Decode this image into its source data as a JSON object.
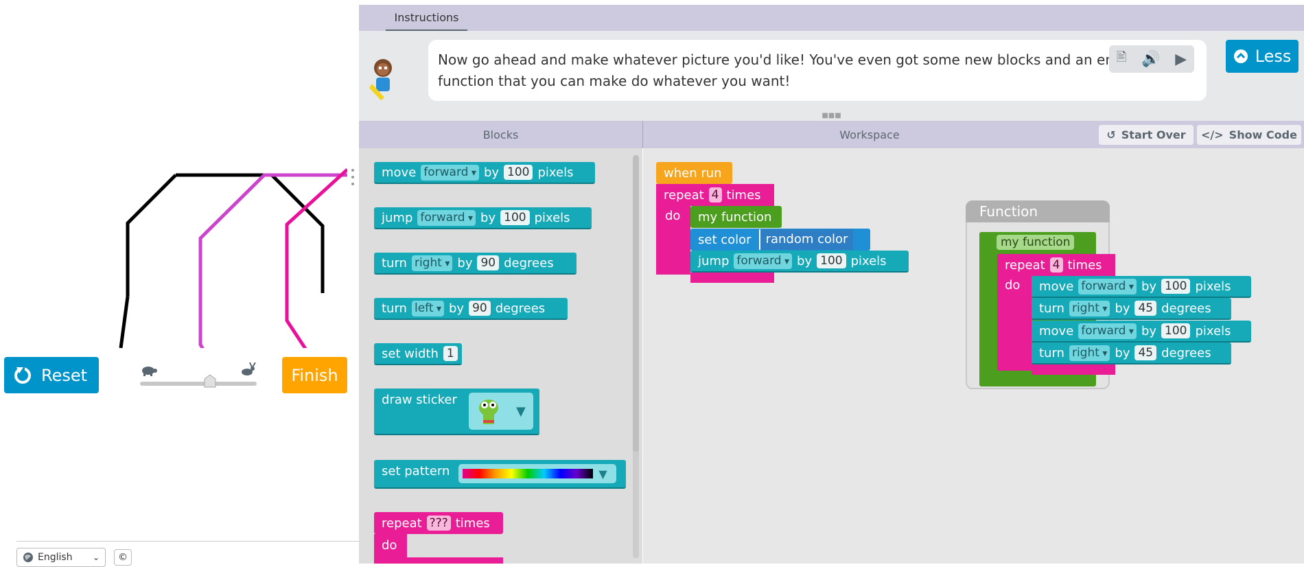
{
  "viz": {
    "reset_label": "Reset",
    "finish_label": "Finish",
    "speed": {
      "level": 0.6
    }
  },
  "footer": {
    "language": "English",
    "copyright": "©"
  },
  "instructions": {
    "tab_label": "Instructions",
    "text": "Now go ahead and make whatever picture you'd like! You've even got some new blocks and an empty function that you can make do whatever you want!",
    "less_label": "Less"
  },
  "headers": {
    "blocks": "Blocks",
    "workspace": "Workspace",
    "start_over": "Start Over",
    "show_code": "Show Code"
  },
  "toolbox": {
    "move": {
      "label": "move",
      "dir": "forward",
      "by": "by",
      "amount": "100",
      "unit": "pixels"
    },
    "jump": {
      "label": "jump",
      "dir": "forward",
      "by": "by",
      "amount": "100",
      "unit": "pixels"
    },
    "turn_right": {
      "label": "turn",
      "dir": "right",
      "by": "by",
      "amount": "90",
      "unit": "degrees"
    },
    "turn_left": {
      "label": "turn",
      "dir": "left",
      "by": "by",
      "amount": "90",
      "unit": "degrees"
    },
    "set_width": {
      "label": "set width",
      "value": "1"
    },
    "draw_sticker": {
      "label": "draw sticker"
    },
    "set_pattern": {
      "label": "set pattern"
    },
    "repeat": {
      "label": "repeat",
      "count": "???",
      "times": "times",
      "do": "do"
    }
  },
  "workspace": {
    "when_run": "when run",
    "repeat": {
      "label": "repeat",
      "count": "4",
      "times": "times",
      "do": "do"
    },
    "call_fn": "my function",
    "set_color": {
      "label": "set color",
      "value": "random color"
    },
    "jump": {
      "label": "jump",
      "dir": "forward",
      "by": "by",
      "amount": "100",
      "unit": "pixels"
    }
  },
  "function_editor": {
    "title": "Function",
    "name": "my function",
    "repeat": {
      "label": "repeat",
      "count": "4",
      "times": "times",
      "do": "do"
    },
    "move1": {
      "label": "move",
      "dir": "forward",
      "by": "by",
      "amount": "100",
      "unit": "pixels"
    },
    "turn1": {
      "label": "turn",
      "dir": "right",
      "by": "by",
      "amount": "45",
      "unit": "degrees"
    },
    "move2": {
      "label": "move",
      "dir": "forward",
      "by": "by",
      "amount": "100",
      "unit": "pixels"
    },
    "turn2": {
      "label": "turn",
      "dir": "right",
      "by": "by",
      "amount": "45",
      "unit": "degrees"
    }
  },
  "colors": {
    "block_teal": "#16aab8",
    "block_pink": "#e91e96",
    "block_green": "#4c9e1f",
    "block_orange": "#f7a51c",
    "button_blue": "#0094ca",
    "button_orange": "#ffa400",
    "header_lavender": "#cdcadf"
  }
}
